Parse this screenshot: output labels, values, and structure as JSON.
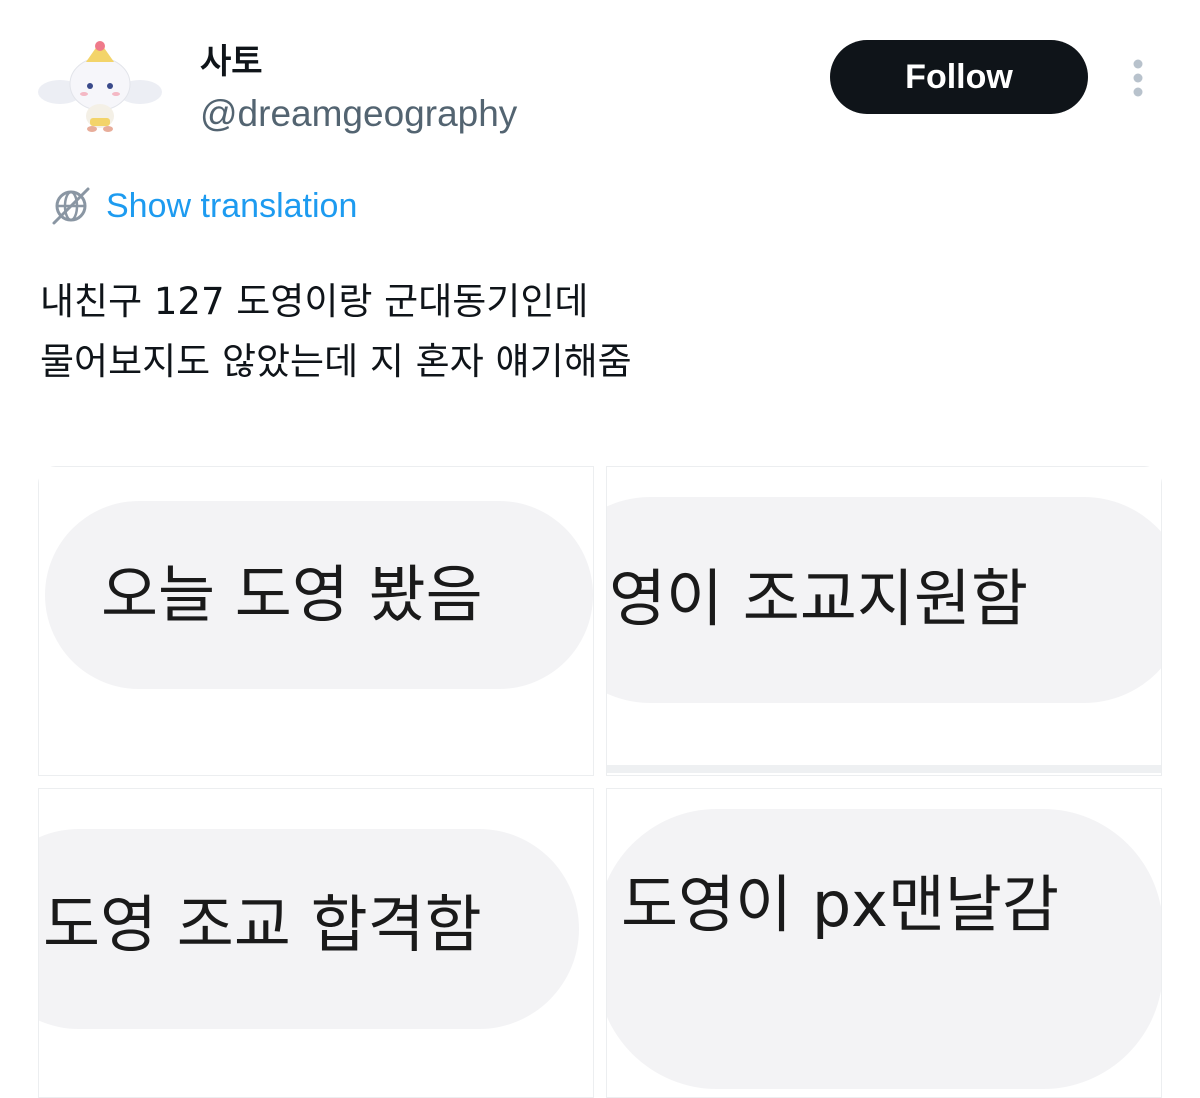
{
  "author": {
    "display_name": "사토",
    "handle": "@dreamgeography",
    "avatar_icon": "character-avatar"
  },
  "actions": {
    "follow_label": "Follow",
    "more_icon": "more-vertical-icon"
  },
  "translation": {
    "label": "Show translation",
    "icon": "globe-icon",
    "color": "#1d9bf0"
  },
  "tweet": {
    "lines": [
      "내친구 127 도영이랑 군대동기인데",
      "물어보지도 않았는데 지 혼자 얘기해줌"
    ]
  },
  "media": [
    {
      "text": "오늘 도영 봤음"
    },
    {
      "text": "영이 조교지원함"
    },
    {
      "text": "도영 조교 합격함"
    },
    {
      "text": "도영이 px맨날감"
    }
  ],
  "colors": {
    "text_primary": "#0f1419",
    "text_secondary": "#536471",
    "follow_bg": "#0f1419",
    "bubble_bg": "#f3f3f5"
  }
}
